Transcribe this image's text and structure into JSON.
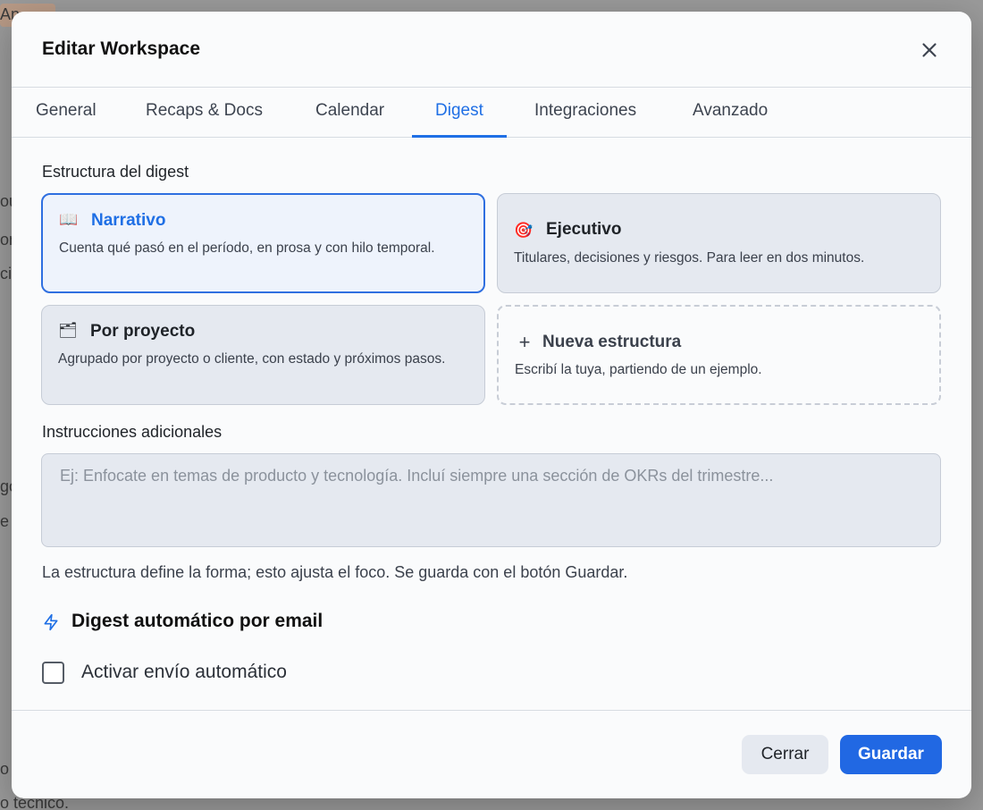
{
  "background": {
    "fragments": [
      "An",
      "ou",
      "on",
      "ci",
      "go",
      "e",
      "o",
      "o técnico."
    ]
  },
  "modal": {
    "title": "Editar Workspace",
    "close_icon": "close-icon"
  },
  "tabs": [
    {
      "label": "General"
    },
    {
      "label": "Recaps & Docs"
    },
    {
      "label": "Calendar"
    },
    {
      "label": "Digest",
      "active": true
    },
    {
      "label": "Integraciones"
    },
    {
      "label": "Avanzado"
    }
  ],
  "structure": {
    "label": "Estructura del digest",
    "cards": [
      {
        "icon": "book-icon",
        "glyph": "📖",
        "title": "Narrativo",
        "desc": "Cuenta qué pasó en el período, en prosa y con hilo temporal.",
        "selected": true
      },
      {
        "icon": "target-icon",
        "glyph": "🎯",
        "title": "Ejecutivo",
        "desc": "Titulares, decisiones y riesgos. Para leer en dos minutos."
      },
      {
        "icon": "folder-icon",
        "glyph": "🗂",
        "title": "Por proyecto",
        "desc": "Agrupado por proyecto o cliente, con estado y próximos pasos."
      },
      {
        "icon": "plus-icon",
        "glyph": "+",
        "title": "Nueva estructura",
        "desc": "Escribí la tuya, partiendo de un ejemplo."
      }
    ]
  },
  "instructions": {
    "label": "Instrucciones adicionales",
    "placeholder": "Ej: Enfocate en temas de producto y tecnología. Incluí siempre una sección de OKRs del trimestre...",
    "hint": "La estructura define la forma; esto ajusta el foco. Se guarda con el botón Guardar."
  },
  "auto_digest": {
    "icon": "bolt-icon",
    "title": "Digest automático por email",
    "checkbox_label": "Activar envío automático",
    "checked": false
  },
  "footer": {
    "close_label": "Cerrar",
    "save_label": "Guardar"
  },
  "colors": {
    "accent": "#1f6fe5",
    "primary_button": "#2168e3",
    "card_bg": "#e5e9f0"
  }
}
